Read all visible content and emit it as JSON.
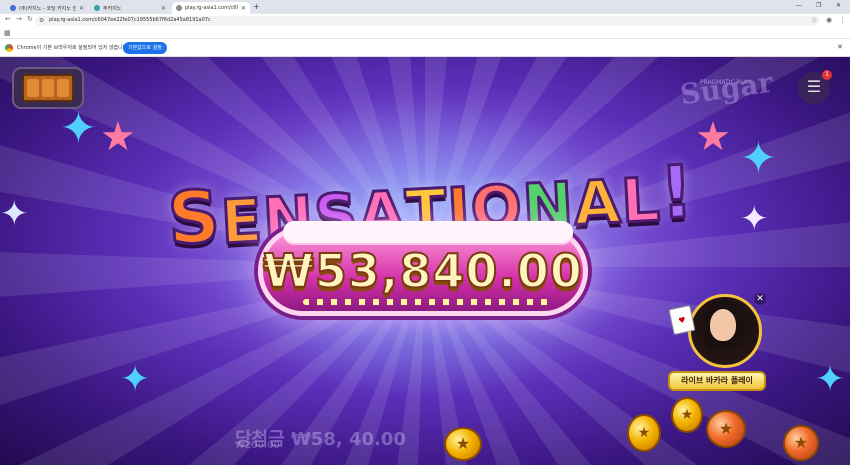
{
  "browser": {
    "tabs": [
      {
        "label": "(주)카지노 - 코딩 카지노 안..."
      },
      {
        "label": "주카지노"
      },
      {
        "label": "play.rg-asia1.com/c604..."
      }
    ],
    "url": "play.rg-asia1.com/c6047ee22fe07c19555b67f6d2a45a8191a07c",
    "infobar_message": "Chrome이 기본 브라우저로 설정되어 있지 않습니다",
    "infobar_button": "기본값으로 설정"
  },
  "game": {
    "headline_letters": [
      {
        "ch": "S",
        "color": "#ff7a2a"
      },
      {
        "ch": "E",
        "color": "#ff9a3a"
      },
      {
        "ch": "N",
        "color": "#ff6fb4"
      },
      {
        "ch": "S",
        "color": "#c95cf0"
      },
      {
        "ch": "A",
        "color": "#ff6fb4"
      },
      {
        "ch": "T",
        "color": "#ffc83a"
      },
      {
        "ch": "I",
        "color": "#ff7a2a"
      },
      {
        "ch": "O",
        "color": "#ff6f6f"
      },
      {
        "ch": "N",
        "color": "#53d36b"
      },
      {
        "ch": "A",
        "color": "#ffb23a"
      },
      {
        "ch": "L",
        "color": "#ff6fb4"
      },
      {
        "ch": "!",
        "color": "#a46cf5"
      }
    ],
    "win_amount": "₩53,840.00",
    "background_logo": "Sugar",
    "background_logo_small": "PRAGMATIC PLAY",
    "menu_badge": "1",
    "background_win_text": "당첨금 ₩58,  40.00",
    "background_bet_text": "₩200.00",
    "dealer_button": "라이브 바카라 플레이"
  },
  "colors": {
    "accent_blue": "#1a73e8",
    "plaque_pink": "#d42fa8",
    "coin_gold": "#f4b400"
  }
}
